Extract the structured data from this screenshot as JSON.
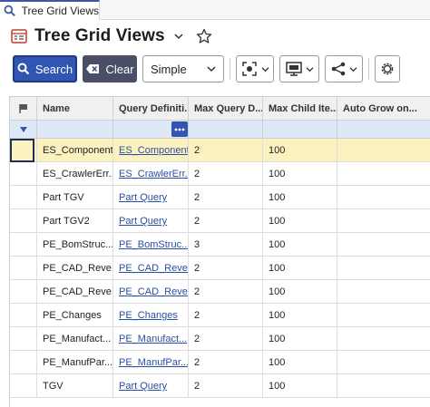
{
  "tab": {
    "label": "Tree Grid Views",
    "icon": "search-icon"
  },
  "header": {
    "title": "Tree Grid Views",
    "icon": "itemtype-icon"
  },
  "toolbar": {
    "search_label": "Search",
    "clear_label": "Clear",
    "view_select_value": "Simple"
  },
  "grid": {
    "columns": [
      "Name",
      "Query Definiti...",
      "Max Query D...",
      "Max Child Ite...",
      "Auto Grow on..."
    ],
    "rows": [
      {
        "name": "ES_Component",
        "query": "ES_Component",
        "max_depth": "2",
        "max_child": "100",
        "selected": true
      },
      {
        "name": "ES_CrawlerErr...",
        "query": "ES_CrawlerErr...",
        "max_depth": "2",
        "max_child": "100"
      },
      {
        "name": "Part TGV",
        "query": "Part Query",
        "max_depth": "2",
        "max_child": "100"
      },
      {
        "name": "Part TGV2",
        "query": "Part Query",
        "max_depth": "2",
        "max_child": "100"
      },
      {
        "name": "PE_BomStruc...",
        "query": "PE_BomStruc...",
        "max_depth": "3",
        "max_child": "100"
      },
      {
        "name": "PE_CAD_Reve...",
        "query": "PE_CAD_Reve...",
        "max_depth": "2",
        "max_child": "100"
      },
      {
        "name": "PE_CAD_Reve...",
        "query": "PE_CAD_Reve...",
        "max_depth": "2",
        "max_child": "100"
      },
      {
        "name": "PE_Changes",
        "query": "PE_Changes",
        "max_depth": "2",
        "max_child": "100"
      },
      {
        "name": "PE_Manufact...",
        "query": "PE_Manufact...",
        "max_depth": "2",
        "max_child": "100"
      },
      {
        "name": "PE_ManufPar...",
        "query": "PE_ManufPar...",
        "max_depth": "2",
        "max_child": "100"
      },
      {
        "name": "TGV",
        "query": "Part Query",
        "max_depth": "2",
        "max_child": "100"
      }
    ]
  },
  "colors": {
    "primary": "#3055b2",
    "clear": "#4a4e66",
    "selected_row": "#fcf2bf",
    "filter_row": "#dfe8f7",
    "link": "#2a4fa6"
  }
}
